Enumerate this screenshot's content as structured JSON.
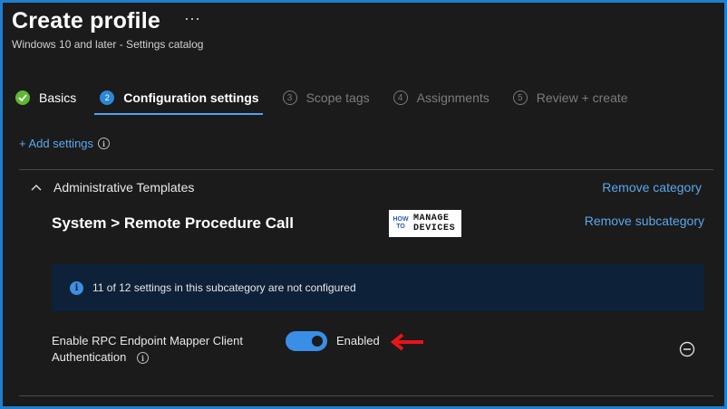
{
  "header": {
    "title": "Create profile",
    "more_glyph": "···",
    "subtitle": "Windows 10 and later - Settings catalog"
  },
  "wizard": {
    "steps": [
      {
        "label": "Basics",
        "number": "",
        "state": "done"
      },
      {
        "label": "Configuration settings",
        "number": "2",
        "state": "current"
      },
      {
        "label": "Scope tags",
        "number": "3",
        "state": "pending"
      },
      {
        "label": "Assignments",
        "number": "4",
        "state": "pending"
      },
      {
        "label": "Review + create",
        "number": "5",
        "state": "pending"
      }
    ]
  },
  "add_settings": {
    "label": "+ Add settings",
    "info_glyph": "i"
  },
  "category": {
    "label": "Administrative Templates",
    "remove_label": "Remove category",
    "subcategory": {
      "title": "System > Remote Procedure Call",
      "remove_label": "Remove subcategory"
    }
  },
  "logo": {
    "line1": "HOW",
    "line2": "TO",
    "line3": "MANAGE",
    "line4": "DEVICES"
  },
  "banner": {
    "info_glyph": "i",
    "text": "11 of 12 settings in this subcategory are not configured"
  },
  "setting": {
    "name": "Enable RPC Endpoint Mapper Client Authentication",
    "info_glyph": "i",
    "toggle_on": true,
    "state_label": "Enabled"
  },
  "colors": {
    "accent": "#3a8ee6",
    "link": "#5aa7ee",
    "success": "#5fb832",
    "annotation_arrow": "#e8141a",
    "banner_bg": "#0d2138"
  },
  "icons": {
    "collapse": "chevron-up-icon",
    "remove": "minus-circle-icon",
    "complete": "checkmark-circle-icon",
    "info": "info-icon"
  }
}
